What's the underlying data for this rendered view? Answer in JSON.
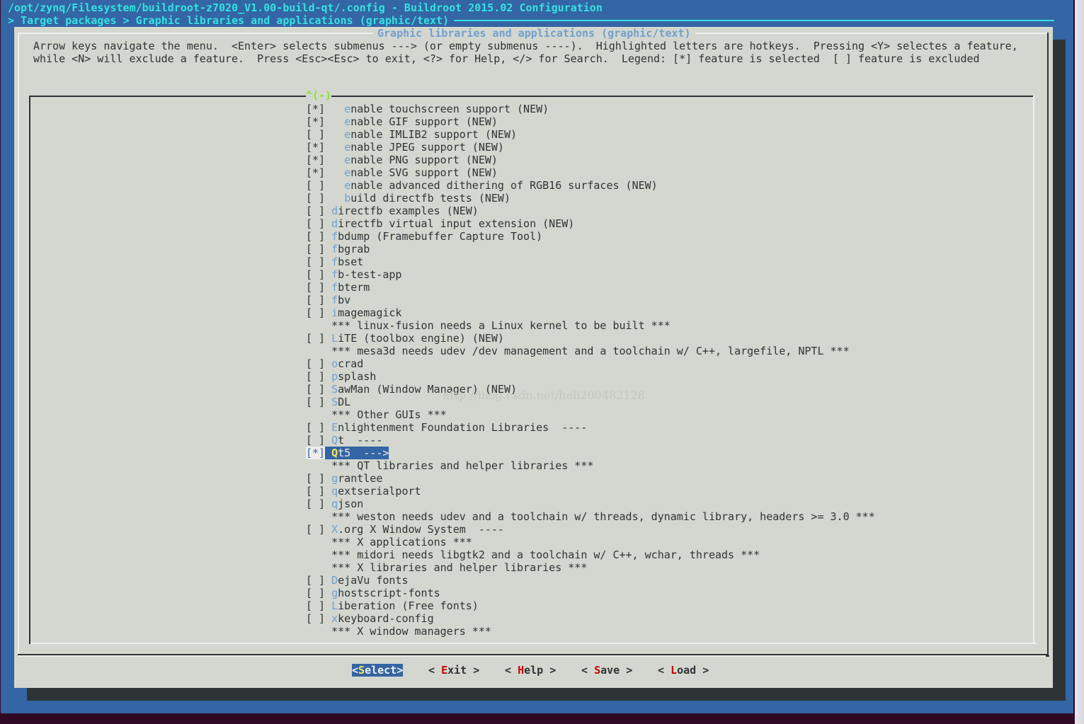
{
  "window": {
    "title": "/opt/zynq/Filesystem/buildroot-z7020_V1.00-build-qt/.config - Buildroot 2015.02 Configuration",
    "breadcrumb": "> Target packages > Graphic libraries and applications (graphic/text)"
  },
  "dialog": {
    "title": "Graphic libraries and applications (graphic/text)",
    "help_line1": "Arrow keys navigate the menu.  <Enter> selects submenus ---> (or empty submenus ----).  Highlighted letters are hotkeys.  Pressing <Y> selectes a feature,",
    "help_line2": "while <N> will exclude a feature.  Press <Esc><Esc> to exit, <?> for Help, </> for Search.  Legend: [*] feature is selected  [ ] feature is excluded",
    "scroll_indicator": "^(-)"
  },
  "items": [
    {
      "mark": "[*]",
      "indent": "  ",
      "hot": "e",
      "rest": "nable touchscreen support (NEW)"
    },
    {
      "mark": "[*]",
      "indent": "  ",
      "hot": "e",
      "rest": "nable GIF support (NEW)"
    },
    {
      "mark": "[ ]",
      "indent": "  ",
      "hot": "e",
      "rest": "nable IMLIB2 support (NEW)"
    },
    {
      "mark": "[*]",
      "indent": "  ",
      "hot": "e",
      "rest": "nable JPEG support (NEW)"
    },
    {
      "mark": "[*]",
      "indent": "  ",
      "hot": "e",
      "rest": "nable PNG support (NEW)"
    },
    {
      "mark": "[*]",
      "indent": "  ",
      "hot": "e",
      "rest": "nable SVG support (NEW)"
    },
    {
      "mark": "[ ]",
      "indent": "  ",
      "hot": "e",
      "rest": "nable advanced dithering of RGB16 surfaces (NEW)"
    },
    {
      "mark": "[ ]",
      "indent": "  ",
      "hot": "b",
      "rest": "uild directfb tests (NEW)"
    },
    {
      "mark": "[ ]",
      "indent": "",
      "hot": "d",
      "rest": "irectfb examples (NEW)"
    },
    {
      "mark": "[ ]",
      "indent": "",
      "hot": "d",
      "rest": "irectfb virtual input extension (NEW)"
    },
    {
      "mark": "[ ]",
      "indent": "",
      "hot": "f",
      "rest": "bdump (Framebuffer Capture Tool)"
    },
    {
      "mark": "[ ]",
      "indent": "",
      "hot": "f",
      "rest": "bgrab"
    },
    {
      "mark": "[ ]",
      "indent": "",
      "hot": "f",
      "rest": "bset"
    },
    {
      "mark": "[ ]",
      "indent": "",
      "hot": "f",
      "rest": "b-test-app"
    },
    {
      "mark": "[ ]",
      "indent": "",
      "hot": "f",
      "rest": "bterm"
    },
    {
      "mark": "[ ]",
      "indent": "",
      "hot": "f",
      "rest": "bv"
    },
    {
      "mark": "[ ]",
      "indent": "",
      "hot": "i",
      "rest": "magemagick"
    },
    {
      "mark": "   ",
      "indent": "",
      "hot": "",
      "rest": "*** linux-fusion needs a Linux kernel to be built ***"
    },
    {
      "mark": "[ ]",
      "indent": "",
      "hot": "L",
      "rest": "iTE (toolbox engine) (NEW)"
    },
    {
      "mark": "   ",
      "indent": "",
      "hot": "",
      "rest": "*** mesa3d needs udev /dev management and a toolchain w/ C++, largefile, NPTL ***"
    },
    {
      "mark": "[ ]",
      "indent": "",
      "hot": "o",
      "rest": "crad"
    },
    {
      "mark": "[ ]",
      "indent": "",
      "hot": "p",
      "rest": "splash"
    },
    {
      "mark": "[ ]",
      "indent": "",
      "hot": "S",
      "rest": "awMan (Window Manager) (NEW)"
    },
    {
      "mark": "[ ]",
      "indent": "",
      "hot": "S",
      "rest": "DL"
    },
    {
      "mark": "   ",
      "indent": "",
      "hot": "",
      "rest": "*** Other GUIs ***"
    },
    {
      "mark": "[ ]",
      "indent": "",
      "hot": "E",
      "rest": "nlightenment Foundation Libraries  ----"
    },
    {
      "mark": "[ ]",
      "indent": "",
      "hot": "Q",
      "rest": "t  ----"
    },
    {
      "mark": "[*]",
      "indent": "",
      "hot": "Q",
      "rest": "t5  --->",
      "selected": true
    },
    {
      "mark": "   ",
      "indent": "",
      "hot": "",
      "rest": "*** QT libraries and helper libraries ***"
    },
    {
      "mark": "[ ]",
      "indent": "",
      "hot": "g",
      "rest": "rantlee"
    },
    {
      "mark": "[ ]",
      "indent": "",
      "hot": "q",
      "rest": "extserialport"
    },
    {
      "mark": "[ ]",
      "indent": "",
      "hot": "q",
      "rest": "json"
    },
    {
      "mark": "   ",
      "indent": "",
      "hot": "",
      "rest": "*** weston needs udev and a toolchain w/ threads, dynamic library, headers >= 3.0 ***"
    },
    {
      "mark": "[ ]",
      "indent": "",
      "hot": "X",
      "rest": ".org X Window System  ----"
    },
    {
      "mark": "   ",
      "indent": "",
      "hot": "",
      "rest": "*** X applications ***"
    },
    {
      "mark": "   ",
      "indent": "",
      "hot": "",
      "rest": "*** midori needs libgtk2 and a toolchain w/ C++, wchar, threads ***"
    },
    {
      "mark": "   ",
      "indent": "",
      "hot": "",
      "rest": "*** X libraries and helper libraries ***"
    },
    {
      "mark": "[ ]",
      "indent": "",
      "hot": "D",
      "rest": "ejaVu fonts"
    },
    {
      "mark": "[ ]",
      "indent": "",
      "hot": "g",
      "rest": "hostscript-fonts"
    },
    {
      "mark": "[ ]",
      "indent": "",
      "hot": "L",
      "rest": "iberation (Free fonts)"
    },
    {
      "mark": "[ ]",
      "indent": "",
      "hot": "x",
      "rest": "keyboard-config"
    },
    {
      "mark": "   ",
      "indent": "",
      "hot": "",
      "rest": "*** X window managers ***"
    }
  ],
  "watermark": "http://blog.csdn.net/heli200482128",
  "buttons": [
    {
      "pre": "<",
      "hot": "S",
      "rest": "elect",
      "post": ">",
      "active": true
    },
    {
      "pre": "< ",
      "hot": "E",
      "rest": "xit",
      "post": " >"
    },
    {
      "pre": "< ",
      "hot": "H",
      "rest": "elp",
      "post": " >"
    },
    {
      "pre": "< ",
      "hot": "S",
      "rest": "ave",
      "post": " >"
    },
    {
      "pre": "< ",
      "hot": "L",
      "rest": "oad",
      "post": " >"
    }
  ],
  "colors": {
    "background_blue": "#3465a4",
    "dialog_gray": "#d3d7cf",
    "title_cyan": "#34e2e2",
    "hotkey_blue": "#729fcf",
    "hotkey_red": "#cc0000",
    "selected_hotkey_yellow": "#fce94f",
    "scroll_green": "#8ae234"
  }
}
